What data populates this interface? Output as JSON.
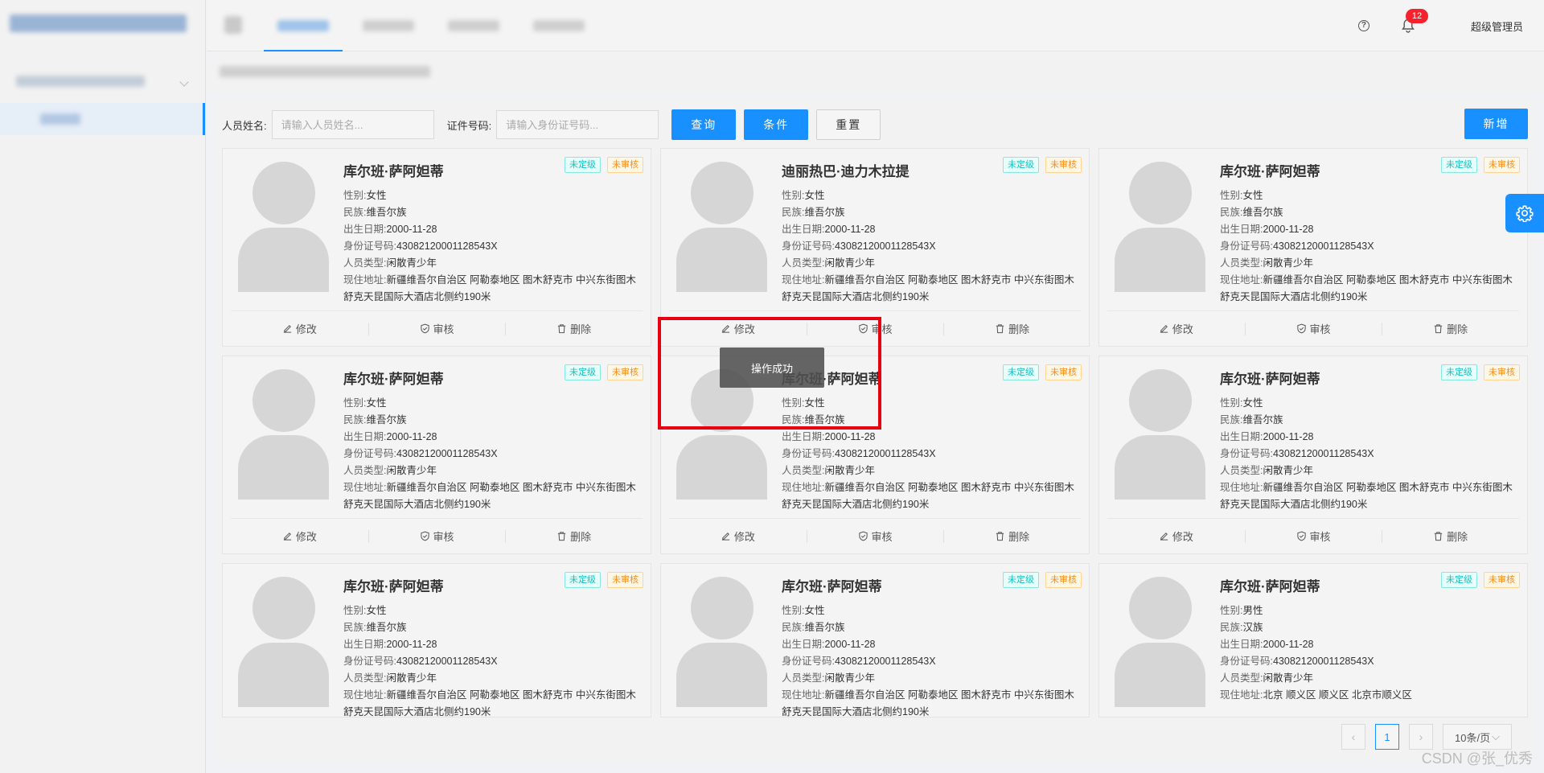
{
  "header": {
    "user": "超级管理员",
    "notification_count": "12",
    "help_glyph": "?"
  },
  "search": {
    "name_label": "人员姓名:",
    "name_placeholder": "请输入人员姓名...",
    "id_label": "证件号码:",
    "id_placeholder": "请输入身份证号码...",
    "query_btn": "查询",
    "filter_btn": "条件",
    "reset_btn": "重置",
    "add_btn": "新增"
  },
  "labels": {
    "gender": "性别:",
    "ethnicity": "民族:",
    "birth": "出生日期:",
    "idno": "身份证号码:",
    "type": "人员类型:",
    "address": "现住地址:"
  },
  "actions": {
    "edit": "修改",
    "audit": "审核",
    "delete": "删除"
  },
  "cards": [
    {
      "name": "库尔班·萨阿妲蒂",
      "tag_grade": "未定级",
      "tag_audit": "未审核",
      "gender": "女性",
      "ethnicity": "维吾尔族",
      "birth": "2000-11-28",
      "idno": "43082120001128543X",
      "type": "闲散青少年",
      "address": "新疆维吾尔自治区 阿勒泰地区 图木舒克市 中兴东街图木舒克天昆国际大酒店北侧约190米"
    },
    {
      "name": "迪丽热巴·迪力木拉提",
      "tag_grade": "未定级",
      "tag_audit": "未审核",
      "gender": "女性",
      "ethnicity": "维吾尔族",
      "birth": "2000-11-28",
      "idno": "43082120001128543X",
      "type": "闲散青少年",
      "address": "新疆维吾尔自治区 阿勒泰地区 图木舒克市 中兴东街图木舒克天昆国际大酒店北侧约190米"
    },
    {
      "name": "库尔班·萨阿妲蒂",
      "tag_grade": "未定级",
      "tag_audit": "未审核",
      "gender": "女性",
      "ethnicity": "维吾尔族",
      "birth": "2000-11-28",
      "idno": "43082120001128543X",
      "type": "闲散青少年",
      "address": "新疆维吾尔自治区 阿勒泰地区 图木舒克市 中兴东街图木舒克天昆国际大酒店北侧约190米"
    },
    {
      "name": "库尔班·萨阿妲蒂",
      "tag_grade": "未定级",
      "tag_audit": "未审核",
      "gender": "女性",
      "ethnicity": "维吾尔族",
      "birth": "2000-11-28",
      "idno": "43082120001128543X",
      "type": "闲散青少年",
      "address": "新疆维吾尔自治区 阿勒泰地区 图木舒克市 中兴东街图木舒克天昆国际大酒店北侧约190米"
    },
    {
      "name": "库尔班·萨阿妲蒂",
      "tag_grade": "未定级",
      "tag_audit": "未审核",
      "gender": "女性",
      "ethnicity": "维吾尔族",
      "birth": "2000-11-28",
      "idno": "43082120001128543X",
      "type": "闲散青少年",
      "address": "新疆维吾尔自治区 阿勒泰地区 图木舒克市 中兴东街图木舒克天昆国际大酒店北侧约190米"
    },
    {
      "name": "库尔班·萨阿妲蒂",
      "tag_grade": "未定级",
      "tag_audit": "未审核",
      "gender": "女性",
      "ethnicity": "维吾尔族",
      "birth": "2000-11-28",
      "idno": "43082120001128543X",
      "type": "闲散青少年",
      "address": "新疆维吾尔自治区 阿勒泰地区 图木舒克市 中兴东街图木舒克天昆国际大酒店北侧约190米"
    },
    {
      "name": "库尔班·萨阿妲蒂",
      "tag_grade": "未定级",
      "tag_audit": "未审核",
      "gender": "女性",
      "ethnicity": "维吾尔族",
      "birth": "2000-11-28",
      "idno": "43082120001128543X",
      "type": "闲散青少年",
      "address": "新疆维吾尔自治区 阿勒泰地区 图木舒克市 中兴东街图木舒克天昆国际大酒店北侧约190米"
    },
    {
      "name": "库尔班·萨阿妲蒂",
      "tag_grade": "未定级",
      "tag_audit": "未审核",
      "gender": "女性",
      "ethnicity": "维吾尔族",
      "birth": "2000-11-28",
      "idno": "43082120001128543X",
      "type": "闲散青少年",
      "address": "新疆维吾尔自治区 阿勒泰地区 图木舒克市 中兴东街图木舒克天昆国际大酒店北侧约190米"
    },
    {
      "name": "库尔班·萨阿妲蒂",
      "tag_grade": "未定级",
      "tag_audit": "未审核",
      "gender": "男性",
      "ethnicity": "汉族",
      "birth": "2000-11-28",
      "idno": "43082120001128543X",
      "type": "闲散青少年",
      "address": "北京 顺义区 顺义区 北京市顺义区"
    }
  ],
  "pagination": {
    "prev": "‹",
    "current": "1",
    "next": "›",
    "page_size": "10条/页"
  },
  "toast": "操作成功",
  "watermark": "CSDN @张_优秀"
}
